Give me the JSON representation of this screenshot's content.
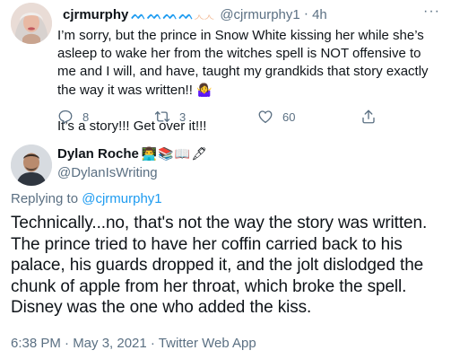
{
  "reply_tweet": {
    "display_name": "cjrmurphy",
    "name_emojis": [
      "wave",
      "wave",
      "wave",
      "wave",
      "flexed-biceps",
      "flexed-biceps"
    ],
    "handle": "@cjrmurphy1",
    "separator": "·",
    "time": "4h",
    "more_label": "···",
    "paragraph_1": "I’m sorry, but the prince in Snow White kissing her while she’s asleep to wake her from the witches spell is NOT offensive to me and I will, and have, taught my grandkids that story exactly the way it was written!!",
    "paragraph_1_emoji": "🤷‍♀️",
    "paragraph_2": "It’s a story!!!  Get over it!!!",
    "reply_count": "8",
    "retweet_count": "3",
    "like_count": "60"
  },
  "main_tweet": {
    "display_name": "Dylan Roche",
    "name_emojis": "👨‍💻📚📖🖋",
    "handle": "@DylanIsWriting",
    "replying_prefix": "Replying to",
    "replying_handle": "@cjrmurphy1",
    "text": "Technically...no, that's not the way the story was written. The prince tried to have her coffin carried back to his palace, his guards dropped it, and the jolt dislodged the chunk of apple from her throat, which broke the spell. Disney was the one who added the kiss.",
    "meta": "6:38 PM · May 3, 2021 · Twitter Web App"
  },
  "colors": {
    "text": "#0f1419",
    "secondary": "#5b7083",
    "link": "#1d9bf0"
  }
}
